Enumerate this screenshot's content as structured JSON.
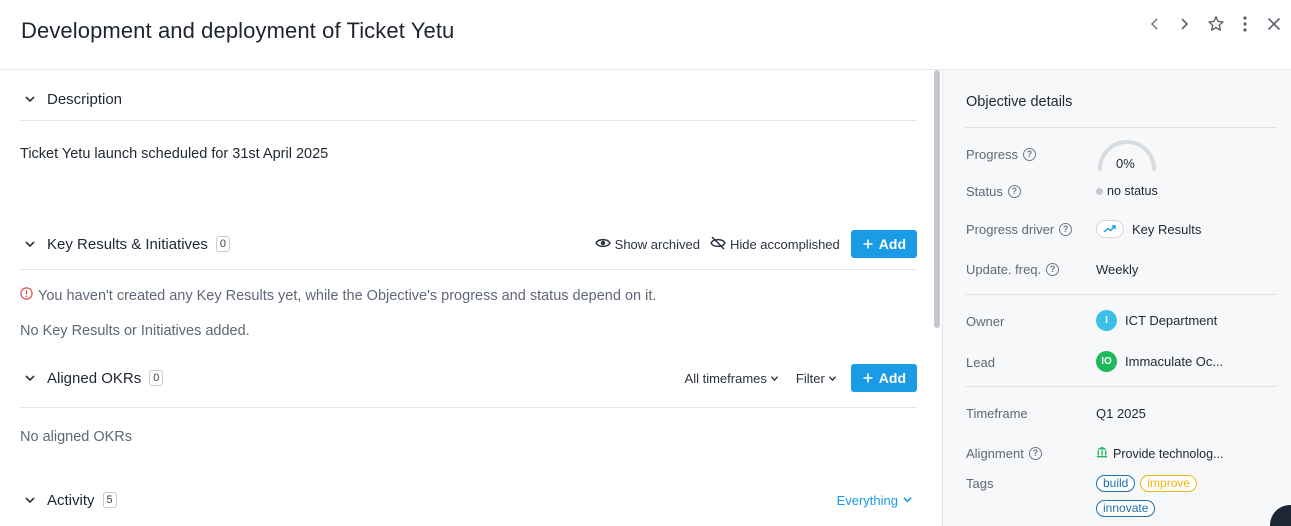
{
  "header": {
    "title": "Development and deployment of Ticket Yetu"
  },
  "description": {
    "heading": "Description",
    "text": "Ticket Yetu launch scheduled for 31st April 2025"
  },
  "key_results": {
    "heading": "Key Results & Initiatives",
    "count": "0",
    "show_archived": "Show archived",
    "hide_accomplished": "Hide accomplished",
    "add_label": "Add",
    "warning": "You haven't created any Key Results yet, while the Objective's progress and status depend on it.",
    "empty": "No Key Results or Initiatives added."
  },
  "aligned": {
    "heading": "Aligned OKRs",
    "count": "0",
    "timeframes": "All timeframes",
    "filter": "Filter",
    "add_label": "Add",
    "empty": "No aligned OKRs"
  },
  "activity": {
    "heading": "Activity",
    "count": "5",
    "filter": "Everything"
  },
  "details": {
    "title": "Objective details",
    "progress_label": "Progress",
    "progress_value": "0%",
    "progress_fraction": 0,
    "status_label": "Status",
    "status_value": "no status",
    "driver_label": "Progress driver",
    "driver_value": "Key Results",
    "freq_label": "Update. freq.",
    "freq_value": "Weekly",
    "owner_label": "Owner",
    "owner_initials": "I",
    "owner_value": "ICT Department",
    "lead_label": "Lead",
    "lead_initials": "IO",
    "lead_value": "Immaculate Oc...",
    "timeframe_label": "Timeframe",
    "timeframe_value": "Q1 2025",
    "alignment_label": "Alignment",
    "alignment_value": "Provide technolog...",
    "tags_label": "Tags",
    "tags": [
      "build",
      "improve",
      "innovate"
    ]
  },
  "colors": {
    "accent": "#1a9be6",
    "owner_avatar": "#3bbfe8",
    "lead_avatar": "#1fb85a",
    "tag_build": "#1d6fb0",
    "tag_improve": "#f2b40f",
    "tag_innovate": "#1d6fb0",
    "warning": "#e24b4b"
  },
  "icons": [
    "chevron-left-icon",
    "chevron-right-icon",
    "star-icon",
    "more-vertical-icon",
    "close-icon",
    "eye-icon",
    "eye-off-icon",
    "plus-icon",
    "warning-icon",
    "help-icon",
    "trend-icon",
    "bank-icon"
  ]
}
